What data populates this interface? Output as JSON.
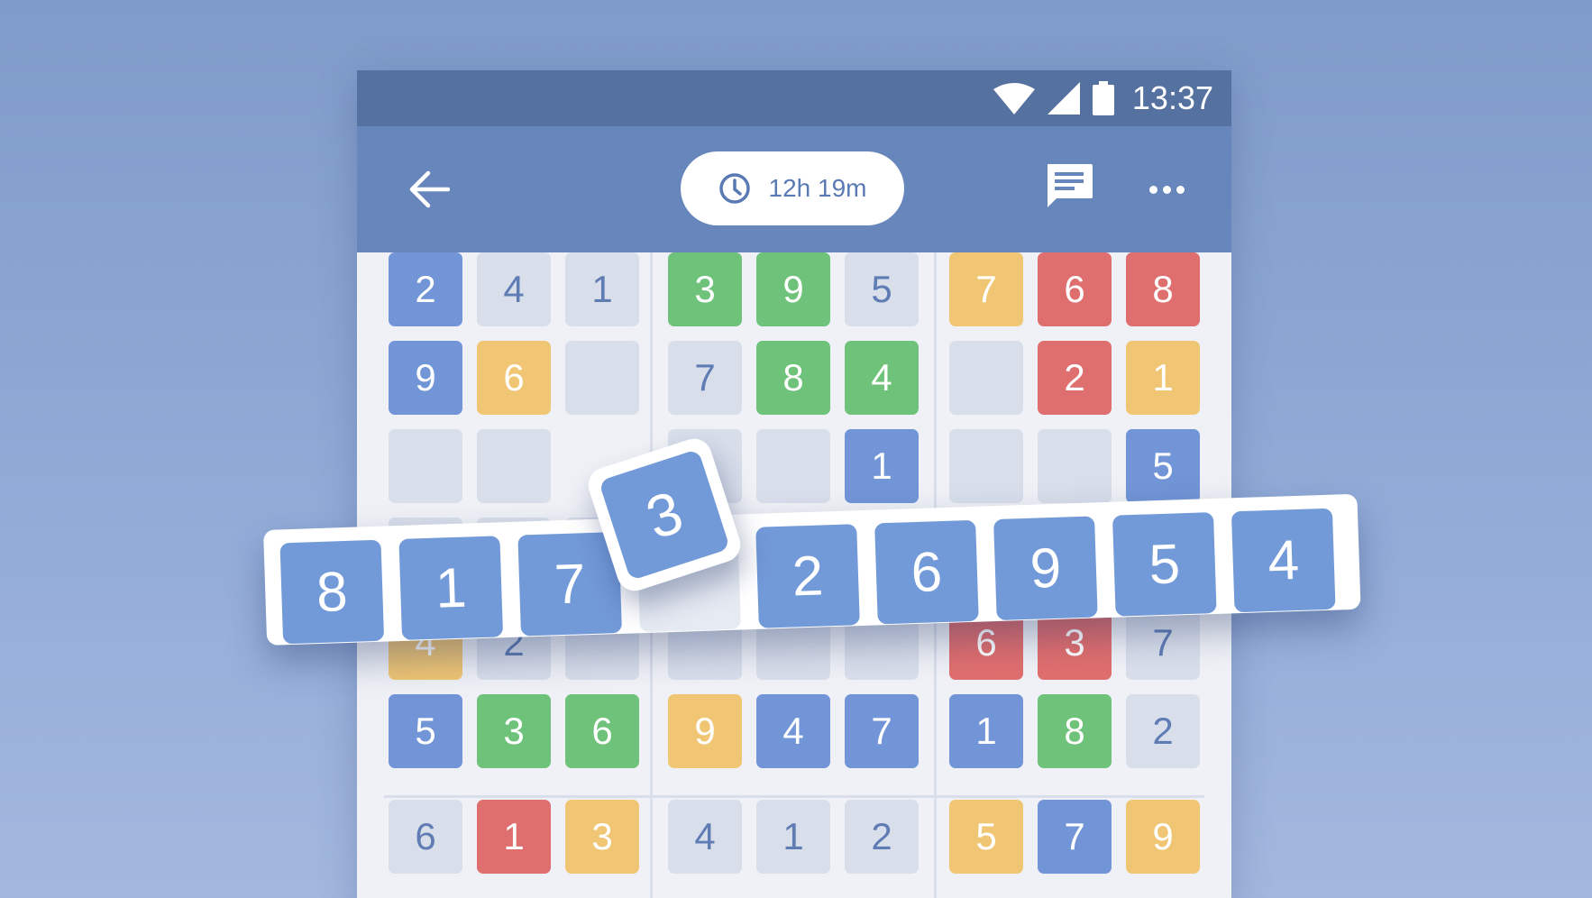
{
  "status_bar": {
    "time": "13:37",
    "icons": [
      "wifi-icon",
      "cell-signal-icon",
      "battery-icon"
    ]
  },
  "app_bar": {
    "back_icon": "back-arrow-icon",
    "timer": {
      "icon": "clock-icon",
      "label": "12h 19m"
    },
    "chat_icon": "chat-icon",
    "more_icon": "more-icon"
  },
  "board": {
    "colors": {
      "blue": "#7195d6",
      "green": "#6ec27a",
      "yellow": "#f0c674",
      "red": "#df6e6e",
      "grey": "#d8deea"
    },
    "rows": [
      [
        [
          "2",
          "blue"
        ],
        [
          "4",
          "grey"
        ],
        [
          "1",
          "grey"
        ],
        [
          "3",
          "green"
        ],
        [
          "9",
          "green"
        ],
        [
          "5",
          "grey"
        ],
        [
          "7",
          "yellow"
        ],
        [
          "6",
          "red"
        ],
        [
          "8",
          "red"
        ]
      ],
      [
        [
          "9",
          "blue"
        ],
        [
          "6",
          "yellow"
        ],
        [
          "",
          "grey"
        ],
        [
          "7",
          "grey"
        ],
        [
          "8",
          "green"
        ],
        [
          "4",
          "green"
        ],
        [
          "",
          "grey"
        ],
        [
          "2",
          "red"
        ],
        [
          "1",
          "yellow"
        ]
      ],
      [
        [
          "",
          "grey"
        ],
        [
          "",
          "grey"
        ],
        [
          "",
          ""
        ],
        [
          "",
          "grey"
        ],
        [
          "",
          "grey"
        ],
        [
          "1",
          "blue"
        ],
        [
          "",
          "grey"
        ],
        [
          "",
          "grey"
        ],
        [
          "5",
          "blue"
        ]
      ],
      [
        [
          "",
          "grey"
        ],
        [
          "",
          "grey"
        ],
        [
          "",
          "grey"
        ],
        [
          "",
          "grey"
        ],
        [
          "",
          "grey"
        ],
        [
          "",
          "grey"
        ],
        [
          "",
          "grey"
        ],
        [
          "",
          "grey"
        ],
        [
          "",
          "grey"
        ]
      ],
      [
        [
          "4",
          "yellow"
        ],
        [
          "2",
          "grey"
        ],
        [
          "",
          "grey"
        ],
        [
          "",
          "grey"
        ],
        [
          "",
          "grey"
        ],
        [
          "",
          "grey"
        ],
        [
          "6",
          "red"
        ],
        [
          "3",
          "red"
        ],
        [
          "7",
          "grey"
        ]
      ],
      [
        [
          "5",
          "blue"
        ],
        [
          "3",
          "green"
        ],
        [
          "6",
          "green"
        ],
        [
          "9",
          "yellow"
        ],
        [
          "4",
          "blue"
        ],
        [
          "7",
          "blue"
        ],
        [
          "1",
          "blue"
        ],
        [
          "8",
          "green"
        ],
        [
          "2",
          "grey"
        ]
      ],
      [
        [
          "6",
          "grey"
        ],
        [
          "1",
          "red"
        ],
        [
          "3",
          "yellow"
        ],
        [
          "4",
          "grey"
        ],
        [
          "1",
          "grey"
        ],
        [
          "2",
          "grey"
        ],
        [
          "5",
          "yellow"
        ],
        [
          "7",
          "blue"
        ],
        [
          "9",
          "yellow"
        ]
      ]
    ]
  },
  "rack": {
    "tiles": [
      "8",
      "1",
      "7",
      "",
      "2",
      "6",
      "9",
      "5",
      "4"
    ],
    "lifted_tile": "3"
  }
}
